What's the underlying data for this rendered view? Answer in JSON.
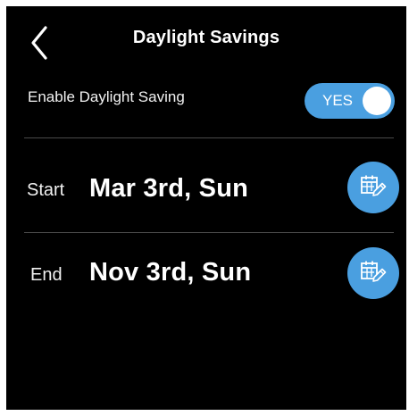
{
  "header": {
    "title": "Daylight Savings",
    "back_icon": "chevron-left-icon"
  },
  "enable_row": {
    "label": "Enable Daylight Saving",
    "toggle_label": "YES",
    "toggle_on": true
  },
  "start": {
    "label": "Start",
    "date": "Mar 3rd, Sun",
    "edit_icon": "calendar-edit-icon"
  },
  "end": {
    "label": "End",
    "date": "Nov 3rd, Sun",
    "edit_icon": "calendar-edit-icon"
  },
  "colors": {
    "background": "#000000",
    "accent": "#4a9fe0",
    "text": "#ffffff",
    "divider": "#4a4a4a"
  }
}
